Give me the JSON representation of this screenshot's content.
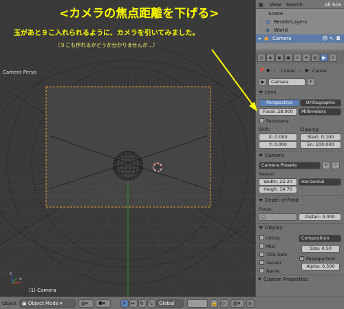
{
  "overlay": {
    "title": "<カメラの焦点距離を下げる>",
    "line1": "玉があと９こ入れられるように、カメラを引いてみました。",
    "line2": "（９こも作れるかどうか分かりませんが…）"
  },
  "viewport": {
    "title": "Camera Persp",
    "status": "(1) Camera"
  },
  "header": {
    "object_label": "Object",
    "mode": "Object Mode",
    "pivot": "Global"
  },
  "outliner": {
    "menu_view": "View",
    "menu_search": "Search",
    "scenes": "All Sce",
    "rows": [
      "Scene",
      "RenderLayers",
      "World",
      "Camera"
    ]
  },
  "properties": {
    "breadcrumb": "Camer",
    "datablock_name": "Camera",
    "datablock_flag": "F",
    "lens": {
      "header": "Lens",
      "perspective": "Perspective",
      "orthographic": "Orthographic",
      "focal": "Focal: 28.000",
      "units": "Millimeters",
      "panorama": "Panorama",
      "shift_label": "Shift:",
      "shift_x": "X: 0.000",
      "shift_y": "Y: 0.000",
      "clipping_label": "Clipping:",
      "clip_start": "Start: 0.100",
      "clip_end": "En: 100.000"
    },
    "camera": {
      "header": "Camera",
      "presets": "Camera Presets",
      "sensor_label": "Sensor:",
      "width": "Width: 22.20",
      "height": "Heigh: 14.70",
      "fit": "Horizontal"
    },
    "dof": {
      "header": "Depth of Field",
      "focus_label": "Focus:",
      "distance": "Distan: 0.000"
    },
    "display": {
      "header": "Display",
      "limits": "Limits",
      "mist": "Mist",
      "title_safe": "Title Safe",
      "sensor": "Sensor",
      "name": "Name",
      "composition": "Composition",
      "size": "Size: 0.50",
      "passepartout": "Passepartout",
      "alpha": "Alpha: 0.500"
    },
    "custom_header": "Custom Properties"
  },
  "colors": {
    "overlay_text": "#ffff00",
    "camera_frame": "#f0a030",
    "active_blue": "#5b7fb5"
  }
}
